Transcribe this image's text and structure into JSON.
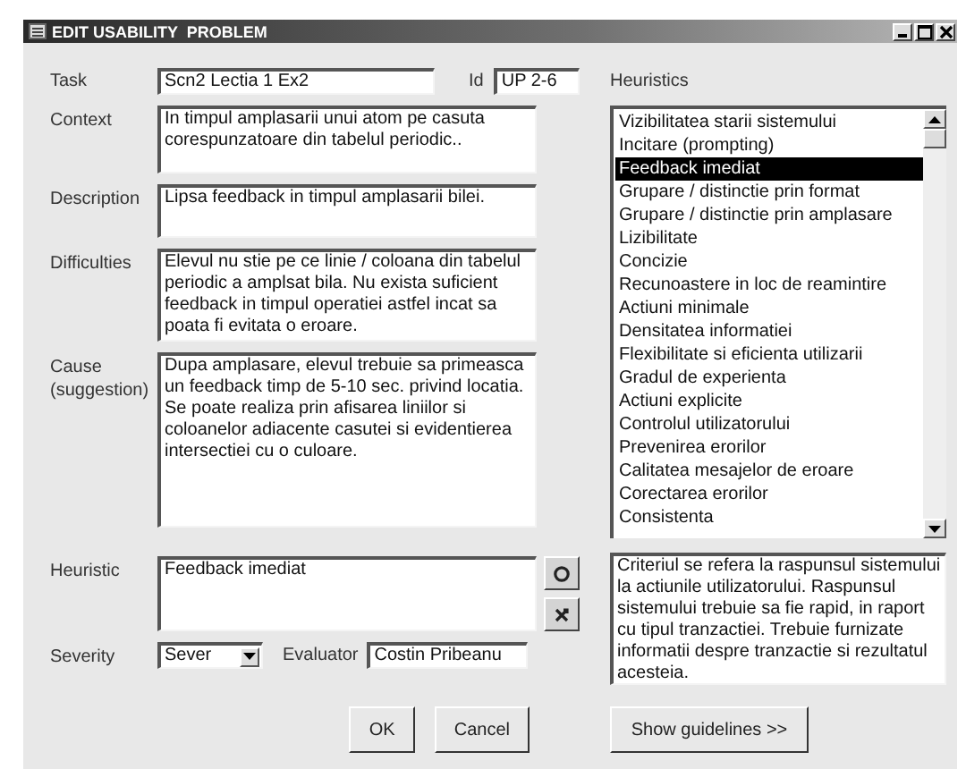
{
  "window": {
    "title": "EDIT USABILITY  PROBLEM"
  },
  "task": {
    "label": "Task",
    "value": "Scn2 Lectia 1 Ex2"
  },
  "id": {
    "label": "Id",
    "value": "UP 2-6"
  },
  "heuristics": {
    "label": "Heuristics",
    "items": [
      {
        "label": "Vizibilitatea starii sistemului",
        "selected": false
      },
      {
        "label": "Incitare (prompting)",
        "selected": false
      },
      {
        "label": "Feedback imediat",
        "selected": true
      },
      {
        "label": "Grupare / distinctie prin format",
        "selected": false
      },
      {
        "label": "Grupare / distinctie prin amplasare",
        "selected": false
      },
      {
        "label": "Lizibilitate",
        "selected": false
      },
      {
        "label": "Concizie",
        "selected": false
      },
      {
        "label": "Recunoastere in loc de reamintire",
        "selected": false
      },
      {
        "label": "Actiuni minimale",
        "selected": false
      },
      {
        "label": "Densitatea informatiei",
        "selected": false
      },
      {
        "label": "Flexibilitate si eficienta utilizarii",
        "selected": false
      },
      {
        "label": "Gradul de experienta",
        "selected": false
      },
      {
        "label": "Actiuni explicite",
        "selected": false
      },
      {
        "label": "Controlul utilizatorului",
        "selected": false
      },
      {
        "label": "Prevenirea erorilor",
        "selected": false
      },
      {
        "label": "Calitatea mesajelor de eroare",
        "selected": false
      },
      {
        "label": "Corectarea erorilor",
        "selected": false
      },
      {
        "label": "Consistenta",
        "selected": false
      }
    ]
  },
  "fields": [
    {
      "label": "Context",
      "value": "In timpul amplasarii unui atom pe casuta corespunzatoare din tabelul periodic.."
    },
    {
      "label": "Description",
      "value": "Lipsa feedback in timpul amplasarii bilei."
    },
    {
      "label": "Difficulties",
      "value": "Elevul nu stie pe ce linie / coloana din tabelul periodic a amplsat bila. Nu exista suficient feedback in timpul operatiei astfel incat sa poata fi evitata o eroare."
    },
    {
      "label": "Cause (suggestion)",
      "value": "Dupa amplasare, elevul trebuie sa primeasca un feedback timp de 5-10 sec. privind locatia. Se poate realiza prin afisarea liniilor si coloanelor adiacente casutei si evidentierea intersectiei cu o culoare."
    }
  ],
  "heuristic": {
    "label": "Heuristic",
    "value": "Feedback imediat"
  },
  "heuristic_description": "Criteriul se refera la raspunsul sistemului la actiunile utilizatorului. Raspunsul sistemului trebuie sa fie rapid, in raport cu tipul tranzactiei. Trebuie furnizate informatii despre tranzactie si rezultatul acesteia.",
  "severity": {
    "label": "Severity",
    "value": "Sever"
  },
  "evaluator": {
    "label": "Evaluator",
    "value": "Costin Pribeanu"
  },
  "buttons": [
    "OK",
    "Cancel"
  ],
  "guidelines_button": "Show guidelines  >>"
}
